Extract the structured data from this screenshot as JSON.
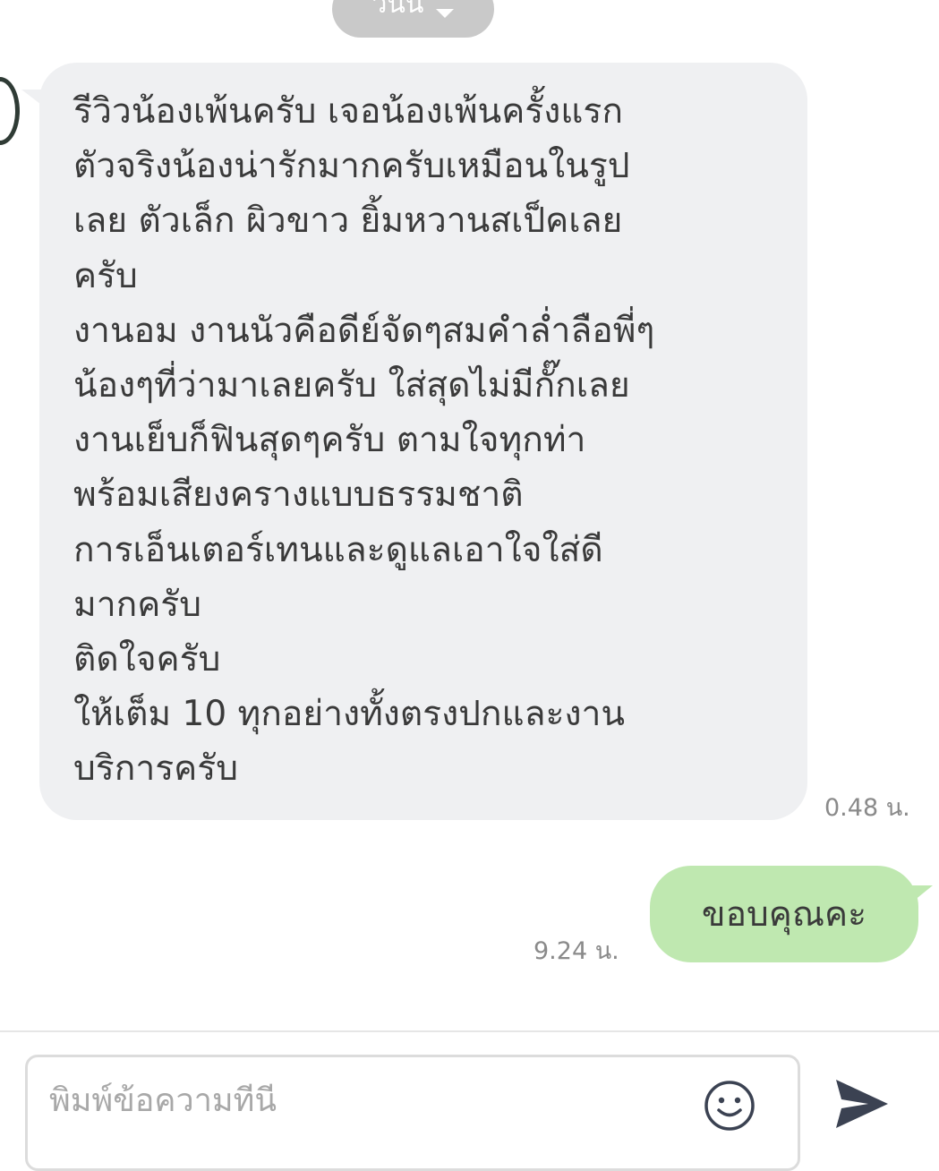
{
  "header": {
    "date_label": "วันนี้"
  },
  "messages": {
    "received": {
      "lines": [
        "รีวิวน้องเพ้นครับ เจอน้องเพ้นครั้งแรก",
        "ตัวจริงน้องน่ารักมากครับเหมือนในรูป",
        "เลย ตัวเล็ก ผิวขาว ยิ้มหวานสเป็คเลย",
        "ครับ",
        "งานอม งานนัวคือดีย์จัดๆสมคำล่ำลือพี่ๆ",
        "น้องๆที่ว่ามาเลยครับ ใส่สุดไม่มีกั๊กเลย",
        "งานเย็บก็ฟินสุดๆครับ ตามใจทุกท่า",
        "พร้อมเสียงครางแบบธรรมชาติ",
        "การเอ็นเตอร์เทนและดูแลเอาใจใส่ดี",
        "มากครับ",
        "ติดใจครับ",
        "ให้เต็ม 10 ทุกอย่างทั้งตรงปกและงาน",
        "บริการครับ"
      ],
      "time": "0.48 น."
    },
    "sent": {
      "text": "ขอบคุณคะ",
      "time": "9.24 น."
    }
  },
  "composer": {
    "placeholder": "พิมพ์ข้อความที่นี่",
    "emoji_icon": "smiley-face-icon",
    "send_icon": "send-arrow-icon"
  },
  "colors": {
    "received_bubble": "#eff0f2",
    "sent_bubble": "#bfe8b0",
    "date_pill": "#c9c9c9",
    "icon": "#3b4252"
  }
}
